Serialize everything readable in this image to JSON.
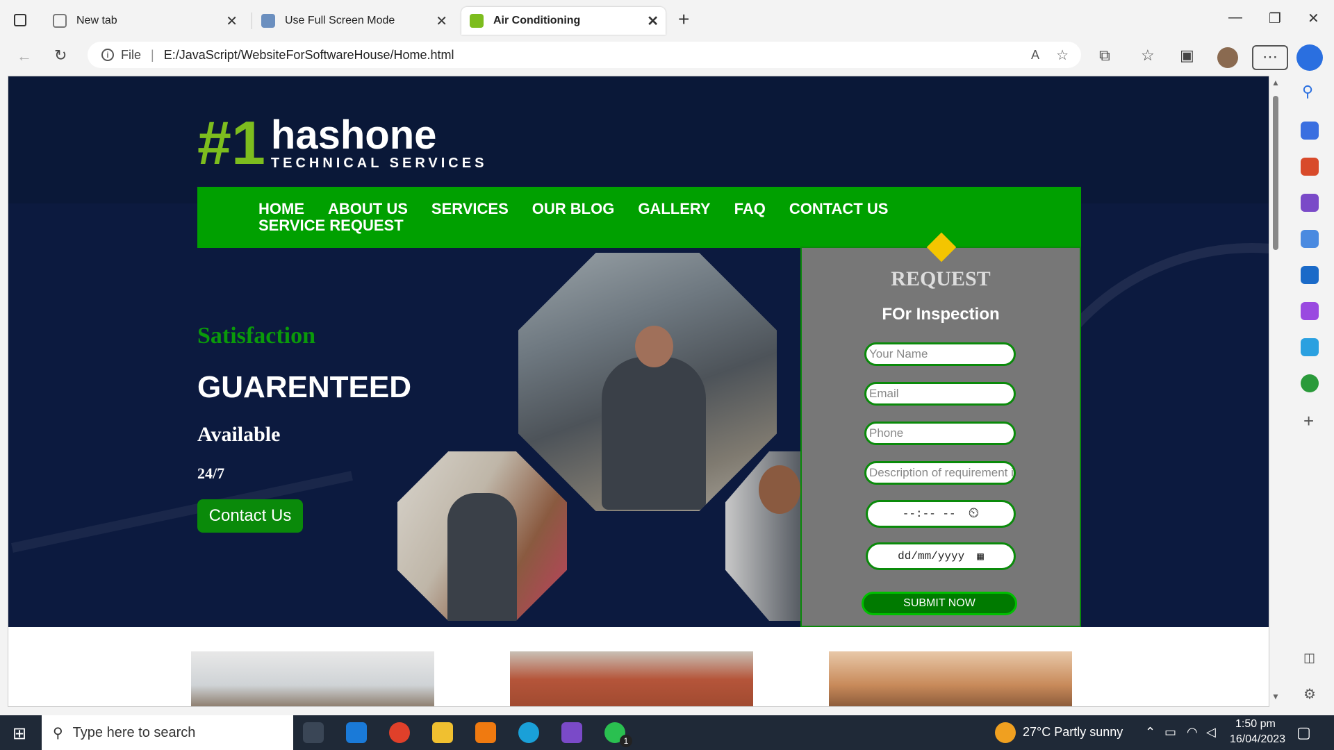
{
  "browser": {
    "tabs": [
      {
        "title": "New tab",
        "active": false
      },
      {
        "title": "Use Full Screen Mode",
        "active": false
      },
      {
        "title": "Air Conditioning",
        "active": true
      }
    ],
    "url_scheme": "File",
    "url": "E:/JavaScript/WebsiteForSoftwareHouse/Home.html"
  },
  "site": {
    "logo": {
      "mark": "#1",
      "name": "hashone",
      "tagline": "TECHNICAL SERVICES"
    },
    "nav": [
      "HOME",
      "ABOUT US",
      "SERVICES",
      "OUR BLOG",
      "GALLERY",
      "FAQ",
      "CONTACT US",
      "SERVICE REQUEST"
    ],
    "hero": {
      "line1": "Satisfaction",
      "line2": "GUARENTEED",
      "line3": "Available",
      "line4": "24/7",
      "cta": "Contact Us"
    },
    "form": {
      "title": "REQUEST",
      "subtitle": "FOr Inspection",
      "name_placeholder": "Your Name",
      "email_placeholder": "Email",
      "phone_placeholder": "Phone",
      "desc_placeholder": "Description of requirement i",
      "time_value": "--:-- --",
      "date_value": "dd/mm/yyyy",
      "submit": "SUBMIT NOW"
    }
  },
  "taskbar": {
    "search_placeholder": "Type here to search",
    "weather": "27°C  Partly sunny",
    "time": "1:50 pm",
    "date": "16/04/2023",
    "whatsapp_badge": "1"
  },
  "colors": {
    "nav_green": "#00a000",
    "hero_navy": "#0c1a3f",
    "form_gray": "#777777"
  }
}
